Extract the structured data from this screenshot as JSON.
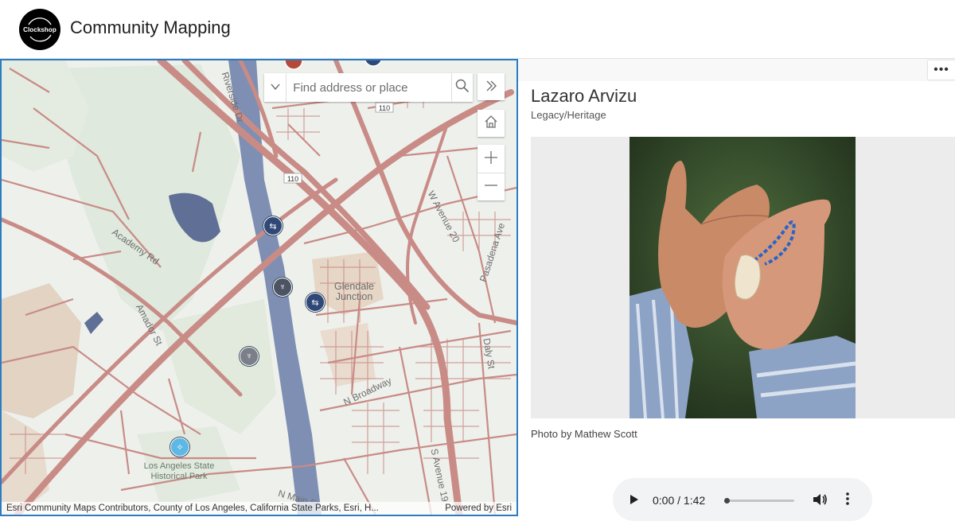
{
  "header": {
    "logo_text": "Clockshop",
    "title": "Community Mapping"
  },
  "map": {
    "search": {
      "placeholder": "Find address or place"
    },
    "icons": {
      "search": "search-icon",
      "dropdown": "caret-down-icon",
      "expand": "double-chevron-right-icon",
      "home": "home-icon",
      "zoom_in": "plus-icon",
      "zoom_out": "minus-icon"
    },
    "labels": {
      "riverside": "Riverside Dr",
      "academy": "Academy Rd",
      "amador": "Amador St",
      "glendale": "Glendale Junction",
      "broadway": "N Broadway",
      "avenue20": "W Avenue 20",
      "pasadena": "Pasadena Ave",
      "daly": "Daly St",
      "avenue19": "S Avenue 19",
      "main": "N Main St",
      "park": "Los Angeles State Historical Park",
      "hwy110a": "110",
      "hwy110b": "110"
    },
    "attribution": "Esri Community Maps Contributors, County of Los Angeles, California State Parks, Esri, H...",
    "powered_by": "Powered by Esri",
    "colors": {
      "river": "#7e8fb3",
      "roads": "#c98b86",
      "park": "#dde8dc",
      "frame": "#2b7cc0"
    }
  },
  "panel": {
    "more": "•••",
    "title": "Lazaro Arvizu",
    "subtitle": "Legacy/Heritage",
    "caption": "Photo by Mathew Scott",
    "audio": {
      "time": "0:00 / 1:42",
      "progress": 0
    }
  }
}
